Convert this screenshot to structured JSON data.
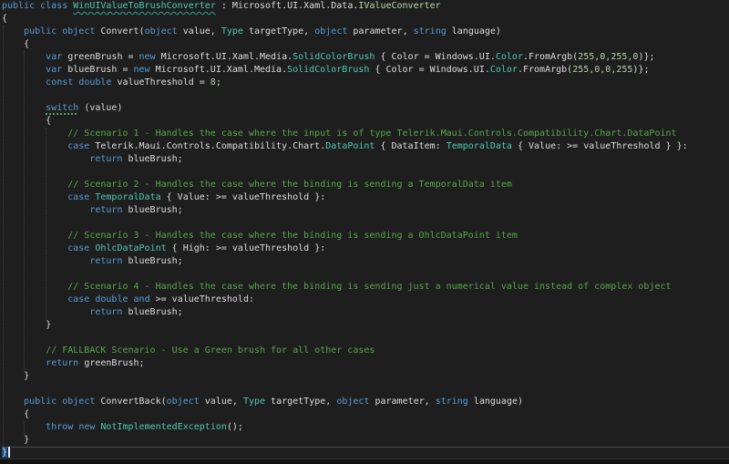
{
  "editor": {
    "language": "csharp",
    "background": "#1e1e1e",
    "colors": {
      "keyword": "#569cd6",
      "type": "#4ec9b0",
      "interface": "#b8d7a3",
      "comment": "#57a64a",
      "plain": "#dcdcdc",
      "number": "#b5cea8",
      "squiggle": "#2ea793",
      "suggestion_dots": "#57a64a",
      "brace_match_highlight": "#14518f",
      "current_line_border": "#4a4a4e"
    },
    "cursor_line_index": 35,
    "code": {
      "lines": [
        [
          {
            "c": "kw",
            "t": "public class "
          },
          {
            "c": "ty",
            "t": "WinUIValueToBrushConverter",
            "u": "wavy"
          },
          {
            "c": "pl",
            "t": " : Microsoft.UI.Xaml.Data."
          },
          {
            "c": "if",
            "t": "IValueConverter"
          }
        ],
        [
          {
            "c": "pl",
            "t": "{"
          }
        ],
        [
          {
            "c": "pl",
            "t": "    "
          },
          {
            "c": "kw",
            "t": "public object "
          },
          {
            "c": "pl",
            "t": "Convert("
          },
          {
            "c": "kw",
            "t": "object"
          },
          {
            "c": "pl",
            "t": " value, "
          },
          {
            "c": "ty",
            "t": "Type"
          },
          {
            "c": "pl",
            "t": " targetType, "
          },
          {
            "c": "kw",
            "t": "object"
          },
          {
            "c": "pl",
            "t": " parameter, "
          },
          {
            "c": "kw",
            "t": "string"
          },
          {
            "c": "pl",
            "t": " language)"
          }
        ],
        [
          {
            "c": "pl",
            "t": "    {"
          }
        ],
        [
          {
            "c": "pl",
            "t": "        "
          },
          {
            "c": "kw",
            "t": "var"
          },
          {
            "c": "pl",
            "t": " greenBrush = "
          },
          {
            "c": "kw",
            "t": "new"
          },
          {
            "c": "pl",
            "t": " Microsoft.UI.Xaml.Media."
          },
          {
            "c": "ty",
            "t": "SolidColorBrush"
          },
          {
            "c": "pl",
            "t": " { Color = Windows.UI."
          },
          {
            "c": "ty",
            "t": "Color"
          },
          {
            "c": "pl",
            "t": ".FromArgb("
          },
          {
            "c": "nm",
            "t": "255,0,255,0"
          },
          {
            "c": "pl",
            "t": ")};"
          }
        ],
        [
          {
            "c": "pl",
            "t": "        "
          },
          {
            "c": "kw",
            "t": "var"
          },
          {
            "c": "pl",
            "t": " blueBrush = "
          },
          {
            "c": "kw",
            "t": "new"
          },
          {
            "c": "pl",
            "t": " Microsoft.UI.Xaml.Media."
          },
          {
            "c": "ty",
            "t": "SolidColorBrush"
          },
          {
            "c": "pl",
            "t": " { Color = Windows.UI."
          },
          {
            "c": "ty",
            "t": "Color"
          },
          {
            "c": "pl",
            "t": ".FromArgb("
          },
          {
            "c": "nm",
            "t": "255,0,0,255"
          },
          {
            "c": "pl",
            "t": ")};"
          }
        ],
        [
          {
            "c": "pl",
            "t": "        "
          },
          {
            "c": "kw",
            "t": "const double"
          },
          {
            "c": "pl",
            "t": " valueThreshold = "
          },
          {
            "c": "nm",
            "t": "8"
          },
          {
            "c": "pl",
            "t": ";"
          }
        ],
        [],
        [
          {
            "c": "pl",
            "t": "        "
          },
          {
            "c": "kw",
            "t": "switch",
            "u": "dots"
          },
          {
            "c": "pl",
            "t": " (value)"
          }
        ],
        [
          {
            "c": "pl",
            "t": "        {"
          }
        ],
        [
          {
            "c": "cm",
            "t": "            // Scenario 1 - Handles the case where the input is of type Telerik.Maui.Controls.Compatibility.Chart.DataPoint"
          }
        ],
        [
          {
            "c": "pl",
            "t": "            "
          },
          {
            "c": "kw",
            "t": "case"
          },
          {
            "c": "pl",
            "t": " Telerik.Maui.Controls.Compatibility.Chart."
          },
          {
            "c": "ty",
            "t": "DataPoint"
          },
          {
            "c": "pl",
            "t": " { DataItem: "
          },
          {
            "c": "ty",
            "t": "TemporalData"
          },
          {
            "c": "pl",
            "t": " { Value: >= valueThreshold } }:"
          }
        ],
        [
          {
            "c": "pl",
            "t": "                "
          },
          {
            "c": "kw",
            "t": "return"
          },
          {
            "c": "pl",
            "t": " blueBrush;"
          }
        ],
        [],
        [
          {
            "c": "cm",
            "t": "            // Scenario 2 - Handles the case where the binding is sending a TemporalData item"
          }
        ],
        [
          {
            "c": "pl",
            "t": "            "
          },
          {
            "c": "kw",
            "t": "case"
          },
          {
            "c": "pl",
            "t": " "
          },
          {
            "c": "ty",
            "t": "TemporalData"
          },
          {
            "c": "pl",
            "t": " { Value: >= valueThreshold }:"
          }
        ],
        [
          {
            "c": "pl",
            "t": "                "
          },
          {
            "c": "kw",
            "t": "return"
          },
          {
            "c": "pl",
            "t": " blueBrush;"
          }
        ],
        [],
        [
          {
            "c": "cm",
            "t": "            // Scenario 3 - Handles the case where the binding is sending a OhlcDataPoint item"
          }
        ],
        [
          {
            "c": "pl",
            "t": "            "
          },
          {
            "c": "kw",
            "t": "case"
          },
          {
            "c": "pl",
            "t": " "
          },
          {
            "c": "ty",
            "t": "OhlcDataPoint"
          },
          {
            "c": "pl",
            "t": " { High: >= valueThreshold }:"
          }
        ],
        [
          {
            "c": "pl",
            "t": "                "
          },
          {
            "c": "kw",
            "t": "return"
          },
          {
            "c": "pl",
            "t": " blueBrush;"
          }
        ],
        [],
        [
          {
            "c": "cm",
            "t": "            // Scenario 4 - Handles the case where the binding is sending just a numerical value instead of complex object"
          }
        ],
        [
          {
            "c": "pl",
            "t": "            "
          },
          {
            "c": "kw",
            "t": "case"
          },
          {
            "c": "pl",
            "t": " "
          },
          {
            "c": "kw",
            "t": "double"
          },
          {
            "c": "pl",
            "t": " "
          },
          {
            "c": "kw",
            "t": "and"
          },
          {
            "c": "pl",
            "t": " >= valueThreshold:"
          }
        ],
        [
          {
            "c": "pl",
            "t": "                "
          },
          {
            "c": "kw",
            "t": "return"
          },
          {
            "c": "pl",
            "t": " blueBrush;"
          }
        ],
        [
          {
            "c": "pl",
            "t": "        }"
          }
        ],
        [],
        [
          {
            "c": "cm",
            "t": "        // FALLBACK Scenario - Use a Green brush for all other cases"
          }
        ],
        [
          {
            "c": "pl",
            "t": "        "
          },
          {
            "c": "kw",
            "t": "return"
          },
          {
            "c": "pl",
            "t": " greenBrush;"
          }
        ],
        [
          {
            "c": "pl",
            "t": "    }"
          }
        ],
        [],
        [
          {
            "c": "pl",
            "t": "    "
          },
          {
            "c": "kw",
            "t": "public object "
          },
          {
            "c": "pl",
            "t": "ConvertBack("
          },
          {
            "c": "kw",
            "t": "object"
          },
          {
            "c": "pl",
            "t": " value, "
          },
          {
            "c": "ty",
            "t": "Type"
          },
          {
            "c": "pl",
            "t": " targetType, "
          },
          {
            "c": "kw",
            "t": "object"
          },
          {
            "c": "pl",
            "t": " parameter, "
          },
          {
            "c": "kw",
            "t": "string"
          },
          {
            "c": "pl",
            "t": " language)"
          }
        ],
        [
          {
            "c": "pl",
            "t": "    {"
          }
        ],
        [
          {
            "c": "pl",
            "t": "        "
          },
          {
            "c": "kw",
            "t": "throw"
          },
          {
            "c": "pl",
            "t": " "
          },
          {
            "c": "kw",
            "t": "new"
          },
          {
            "c": "pl",
            "t": " "
          },
          {
            "c": "ty",
            "t": "NotImplementedException"
          },
          {
            "c": "pl",
            "t": "();"
          }
        ],
        [
          {
            "c": "pl",
            "t": "    }"
          }
        ],
        [
          {
            "c": "pl",
            "t": "}",
            "h": true
          }
        ]
      ]
    }
  }
}
